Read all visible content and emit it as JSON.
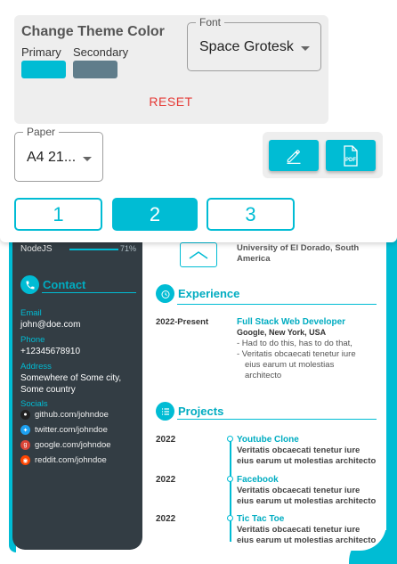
{
  "theme": {
    "title": "Change Theme Color",
    "primary_label": "Primary",
    "secondary_label": "Secondary",
    "primary_color": "#00bcd4",
    "secondary_color": "#607d8b",
    "reset_label": "RESET"
  },
  "font_select": {
    "legend": "Font",
    "value": "Space Grotesk"
  },
  "paper_select": {
    "legend": "Paper",
    "value": "A4 21..."
  },
  "actions": {
    "edit_icon": "pencil-icon",
    "pdf_icon": "pdf-file-icon"
  },
  "pages": [
    {
      "label": "1",
      "active": false
    },
    {
      "label": "2",
      "active": true
    },
    {
      "label": "3",
      "active": false
    }
  ],
  "resume": {
    "skill": {
      "name": "NodeJS",
      "percent": "71%"
    },
    "contact": {
      "title": "Contact",
      "email_label": "Email",
      "email": "john@doe.com",
      "phone_label": "Phone",
      "phone": "+12345678910",
      "address_label": "Address",
      "address": "Somewhere of Some city, Some country",
      "socials_label": "Socials",
      "socials": [
        {
          "text": "github.com/johndoe",
          "icon": "github-icon",
          "color": "#212121"
        },
        {
          "text": "twitter.com/johndoe",
          "icon": "twitter-icon",
          "color": "#1da1f2"
        },
        {
          "text": "google.com/johndoe",
          "icon": "google-icon",
          "color": "#db4437"
        },
        {
          "text": "reddit.com/johndoe",
          "icon": "reddit-icon",
          "color": "#ff4500"
        }
      ]
    },
    "education_tail": {
      "line1": "University of El Dorado, South",
      "line2": "America"
    },
    "experience": {
      "title": "Experience",
      "period": "2022-Present",
      "job_title": "Full Stack Web Developer",
      "company": "Google, New York, USA",
      "bullet1": "- Had to do this, has to do that,",
      "bullet2_l1": "- Veritatis obcaecati tenetur iure",
      "bullet2_l2": "eius earum ut molestias",
      "bullet2_l3": "architecto"
    },
    "projects": {
      "title": "Projects",
      "items": [
        {
          "year": "2022",
          "title": "Youtube Clone",
          "desc_l1": "Veritatis obcaecati tenetur iure",
          "desc_l2": "eius earum ut molestias architecto"
        },
        {
          "year": "2022",
          "title": "Facebook",
          "desc_l1": "Veritatis obcaecati tenetur iure",
          "desc_l2": "eius earum ut molestias architecto"
        },
        {
          "year": "2022",
          "title": "Tic Tac Toe",
          "desc_l1": "Veritatis obcaecati tenetur iure",
          "desc_l2": "eius earum ut molestias architecto"
        }
      ]
    }
  }
}
